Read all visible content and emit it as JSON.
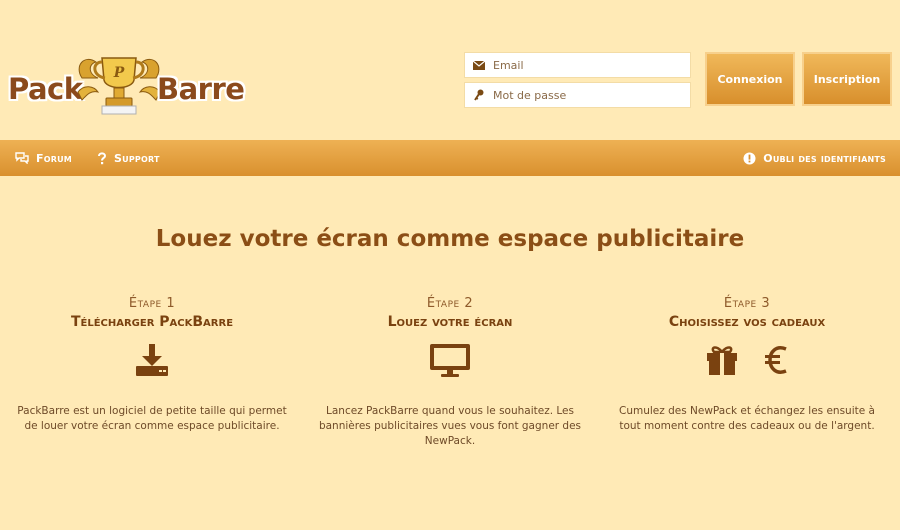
{
  "brand": {
    "word1": "Pack",
    "word2": "Barre",
    "trophy_letter": "P"
  },
  "login": {
    "email_placeholder": "Email",
    "password_placeholder": "Mot de passe",
    "login_label": "Connexion",
    "register_label": "Inscription"
  },
  "nav": {
    "forum": "Forum",
    "support": "Support",
    "forgot": "Oubli des identifiants"
  },
  "main": {
    "headline": "Louez votre écran comme espace publicitaire",
    "steps": [
      {
        "number": "Étape 1",
        "title": "Télécharger PackBarre",
        "icon": "download-icon",
        "description": "PackBarre est un logiciel de petite taille qui permet de louer votre écran comme espace publicitaire."
      },
      {
        "number": "Étape 2",
        "title": "Louez votre écran",
        "icon": "monitor-icon",
        "description": "Lancez PackBarre quand vous le souhaitez. Les bannières publicitaires vues vous font gagner des NewPack."
      },
      {
        "number": "Étape 3",
        "title": "Choisissez vos cadeaux",
        "icons": [
          "gift-icon",
          "euro-icon"
        ],
        "description": "Cumulez des NewPack et échangez les ensuite à tout moment contre des cadeaux ou de l'argent."
      }
    ]
  },
  "colors": {
    "background": "#ffeab6",
    "accent": "#e3a13f",
    "text_dark": "#7a4210"
  }
}
